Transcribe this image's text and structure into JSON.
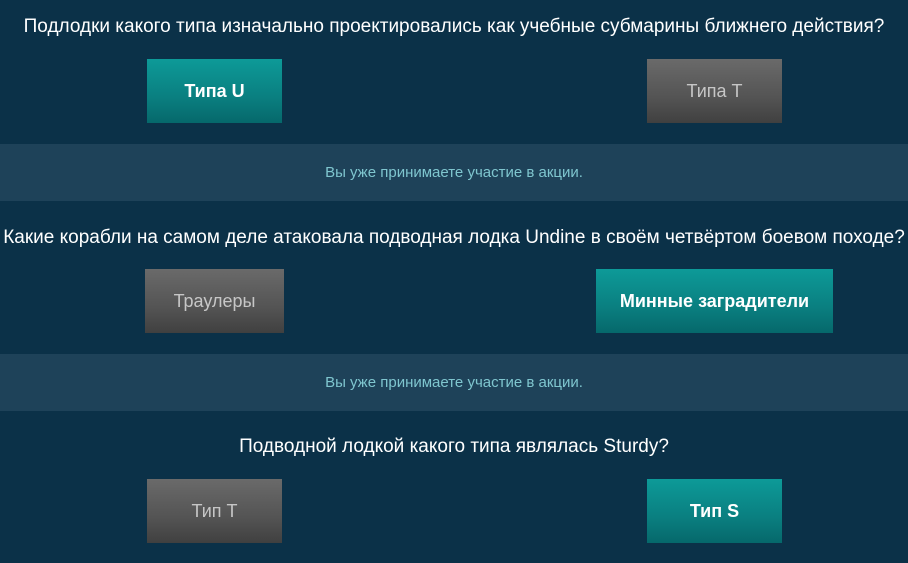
{
  "questions": [
    {
      "text": "Подлодки какого типа изначально проектировались как учебные субмарины ближнего действия?",
      "answers": [
        {
          "label": "Типа U",
          "state": "selected"
        },
        {
          "label": "Типа T",
          "state": "unselected"
        }
      ]
    },
    {
      "text": "Какие корабли на самом деле атаковала подводная лодка Undine в своём четвёртом боевом походе?",
      "answers": [
        {
          "label": "Траулеры",
          "state": "unselected"
        },
        {
          "label": "Минные заградители",
          "state": "selected"
        }
      ]
    },
    {
      "text": "Подводной лодкой какого типа являлась Sturdy?",
      "answers": [
        {
          "label": "Тип T",
          "state": "unselected"
        },
        {
          "label": "Тип S",
          "state": "selected"
        }
      ]
    }
  ],
  "notices": [
    "Вы уже принимаете участие в акции.",
    "Вы уже принимаете участие в акции."
  ],
  "colors": {
    "background": "#0b3148",
    "notice_band": "#1e4259",
    "notice_text": "#7fc6cf",
    "selected_answer": "#0a7f80",
    "unselected_answer": "#545454"
  }
}
